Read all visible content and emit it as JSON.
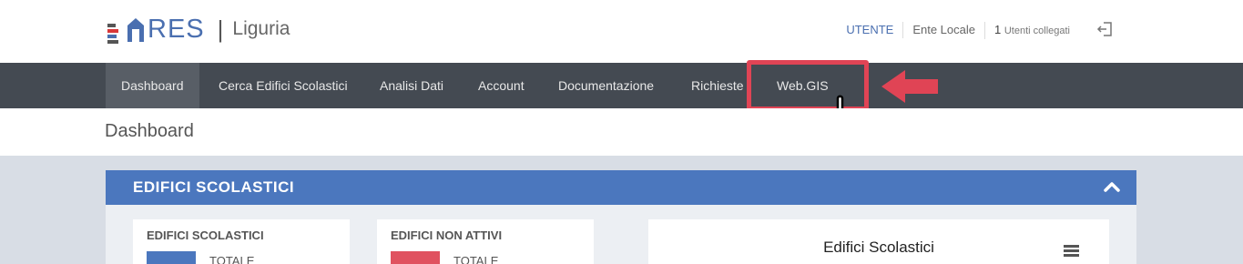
{
  "brand": {
    "logo_text": "RES",
    "separator": "|",
    "region": "Liguria",
    "colors": {
      "blue": "#4a6fb0",
      "red": "#d9383a",
      "gray": "#555555"
    }
  },
  "user": {
    "role": "UTENTE",
    "org": "Ente Locale",
    "connected_count": "1",
    "connected_label": "Utenti collegati",
    "logout_icon": "logout-icon"
  },
  "nav": {
    "items": [
      {
        "label": "Dashboard",
        "active": true
      },
      {
        "label": "Cerca Edifici Scolastici"
      },
      {
        "label": "Analisi Dati"
      },
      {
        "label": "Account"
      },
      {
        "label": "Documentazione"
      },
      {
        "label": "Richieste"
      },
      {
        "label": "Web.GIS",
        "highlighted": true
      }
    ],
    "highlight_color": "#e04455"
  },
  "page": {
    "title": "Dashboard"
  },
  "panel": {
    "title": "EDIFICI SCOLASTICI",
    "cards": [
      {
        "title": "EDIFICI SCOLASTICI",
        "total_label": "TOTALE",
        "color": "#4b77be"
      },
      {
        "title": "EDIFICI NON ATTIVI",
        "total_label": "TOTALE",
        "color": "#e05260"
      }
    ],
    "chart": {
      "title": "Edifici Scolastici"
    }
  }
}
